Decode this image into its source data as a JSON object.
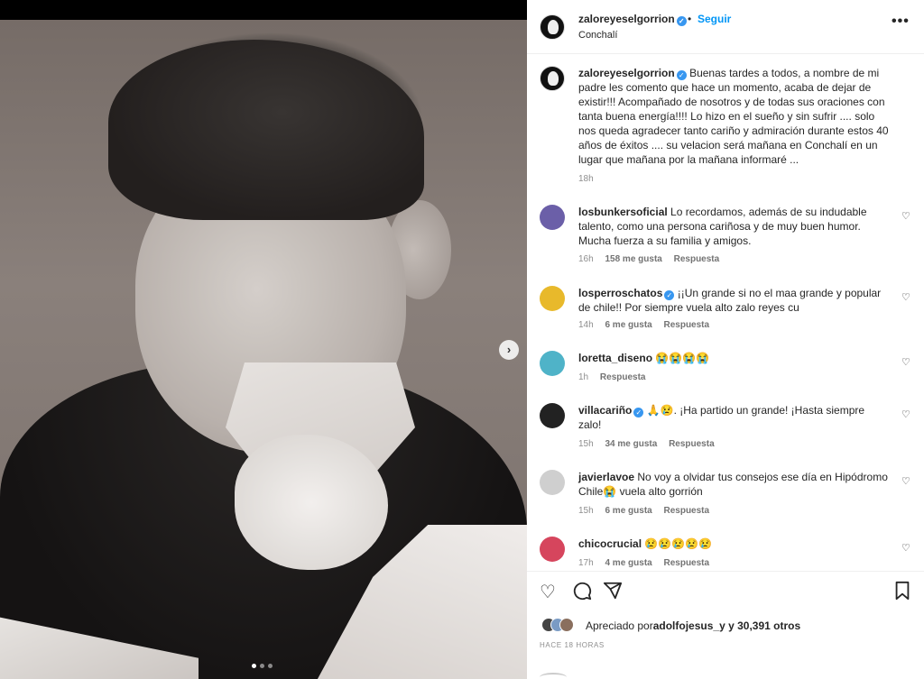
{
  "post": {
    "username": "zaloreyeselgorrion",
    "follow_label": "Seguir",
    "separator": "•",
    "location": "Conchalí",
    "more_label": "•••",
    "caption": "Buenas tardes a todos, a nombre de mi padre les comento que hace un momento, acaba de dejar de existir!!! Acompañado de nosotros y de todas sus oraciones con tanta buena energía!!!! Lo hizo en el sueño y sin sufrir .... solo nos queda agradecer tanto cariño y admiración durante estos 40 años de éxitos .... su velacion será mañana en Conchalí en un lugar que mañana por la mañana informaré ...",
    "caption_time": "18h"
  },
  "comments": [
    {
      "user": "losbunkersoficial",
      "verified": false,
      "text": "Lo recordamos, además de su indudable talento, como una persona cariñosa y de muy buen humor. Mucha fuerza a su familia y amigos.",
      "time": "16h",
      "likes": "158 me gusta",
      "reply": "Respuesta",
      "avatar_color": "#6b5fa8"
    },
    {
      "user": "losperroschatos",
      "verified": true,
      "text": "¡¡Un grande si no el maa grande y popular de chile!! Por siempre vuela alto zalo reyes cu",
      "time": "14h",
      "likes": "6 me gusta",
      "reply": "Respuesta",
      "avatar_color": "#e8b92b"
    },
    {
      "user": "loretta_diseno",
      "verified": false,
      "text": "😭😭😭😭",
      "time": "1h",
      "likes": "",
      "reply": "Respuesta",
      "avatar_color": "#4fb3c8"
    },
    {
      "user": "villacariño",
      "verified": true,
      "text": "🙏😢. ¡Ha partido un grande! ¡Hasta siempre zalo!",
      "time": "15h",
      "likes": "34 me gusta",
      "reply": "Respuesta",
      "avatar_color": "#222222"
    },
    {
      "user": "javierlavoe",
      "verified": false,
      "text": "No voy a olvidar tus consejos ese día en Hipódromo Chile😭 vuela alto gorrión",
      "time": "15h",
      "likes": "6 me gusta",
      "reply": "Respuesta",
      "avatar_color": "#cfcfcf"
    },
    {
      "user": "chicocrucial",
      "verified": false,
      "text": "😢😢😢😢😢",
      "time": "17h",
      "likes": "4 me gusta",
      "reply": "Respuesta",
      "avatar_color": "#d6455d"
    }
  ],
  "actions": {
    "likes_prefix": "Apreciado por",
    "likes_user": "adolfojesus_y",
    "likes_count": "30,391 otros",
    "time_ago": "Hace 18 horas"
  },
  "media": {
    "next_label": "›",
    "carousel_total": 3,
    "carousel_active": 1
  }
}
